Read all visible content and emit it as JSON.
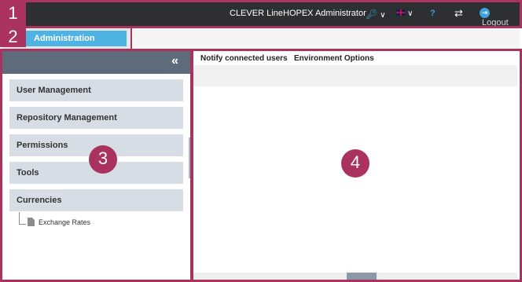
{
  "topbar": {
    "library": "CLEVER Line",
    "profile": "HOPEX Administrator",
    "key_icon": "key-icon",
    "flag_icon": "uk-flag-icon",
    "help_icon": "help-icon",
    "switch_icon": "switch-icon",
    "logout_icon": "logout-icon",
    "logout_label": "Logout"
  },
  "tabs": {
    "active": "Administration"
  },
  "sidebar": {
    "collapse_icon": "«",
    "items": [
      {
        "label": "User Management"
      },
      {
        "label": "Repository Management"
      },
      {
        "label": "Permissions"
      },
      {
        "label": "Tools"
      },
      {
        "label": "Currencies"
      }
    ],
    "tree": [
      {
        "label": "Exchange Rates"
      }
    ]
  },
  "main": {
    "tabs": [
      {
        "label": "Notify connected users"
      },
      {
        "label": "Environment Options"
      }
    ]
  },
  "callouts": [
    "1",
    "2",
    "3",
    "4"
  ],
  "colors": {
    "callout": "#a9325f",
    "accent": "#4fb3e1",
    "topbar": "#2d2f31",
    "sidebar_header": "#5d6b7a",
    "menu_item": "#d7dde5"
  }
}
